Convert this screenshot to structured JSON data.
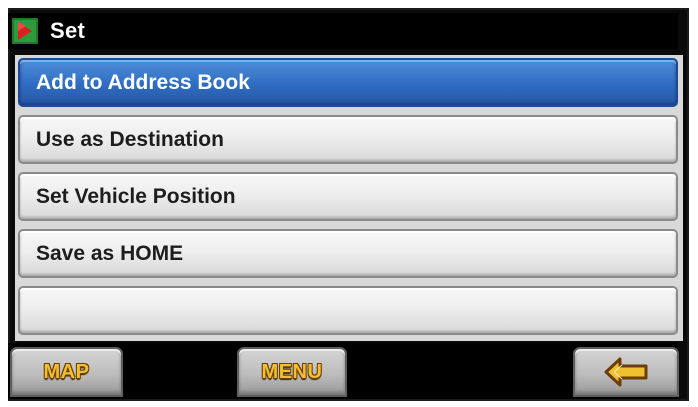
{
  "header": {
    "title": "Set",
    "icon": "nav-flag-icon"
  },
  "menu": {
    "items": [
      {
        "label": "Add to Address Book",
        "selected": true
      },
      {
        "label": "Use as Destination",
        "selected": false
      },
      {
        "label": "Set Vehicle Position",
        "selected": false
      },
      {
        "label": "Save as HOME",
        "selected": false
      },
      {
        "label": "",
        "selected": false
      }
    ]
  },
  "footer": {
    "map_label": "MAP",
    "menu_label": "MENU",
    "back_icon": "back-arrow-icon"
  },
  "colors": {
    "selected": "#2f6cc2",
    "button_text": "#f0c030",
    "bar": "#000000"
  }
}
